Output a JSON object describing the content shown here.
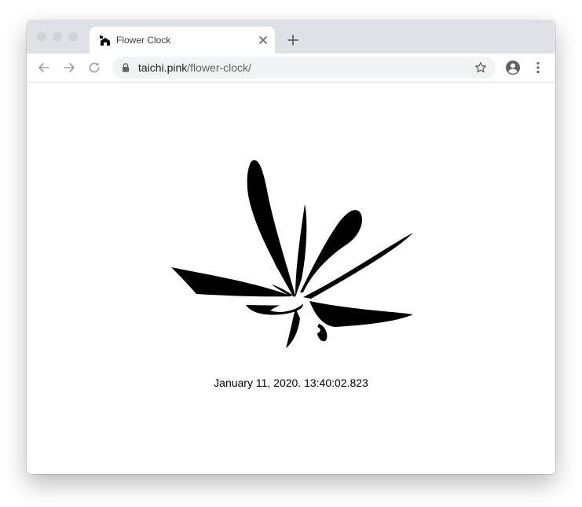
{
  "tab": {
    "title": "Flower Clock"
  },
  "address": {
    "host": "taichi.pink",
    "path": "/flower-clock/"
  },
  "page": {
    "clock_text": "January 11, 2020. 13:40:02.823"
  },
  "colors": {
    "tabstrip": "#dee1e6",
    "omnibox": "#f1f3f4",
    "ink": "#000000"
  },
  "icons": {
    "favicon": "cat-on-roof-icon",
    "close": "close-icon",
    "new_tab": "plus-icon",
    "back": "arrow-left-icon",
    "forward": "arrow-right-icon",
    "reload": "reload-icon",
    "lock": "lock-icon",
    "bookmark": "star-icon",
    "profile": "account-icon",
    "menu": "kebab-menu-icon"
  }
}
